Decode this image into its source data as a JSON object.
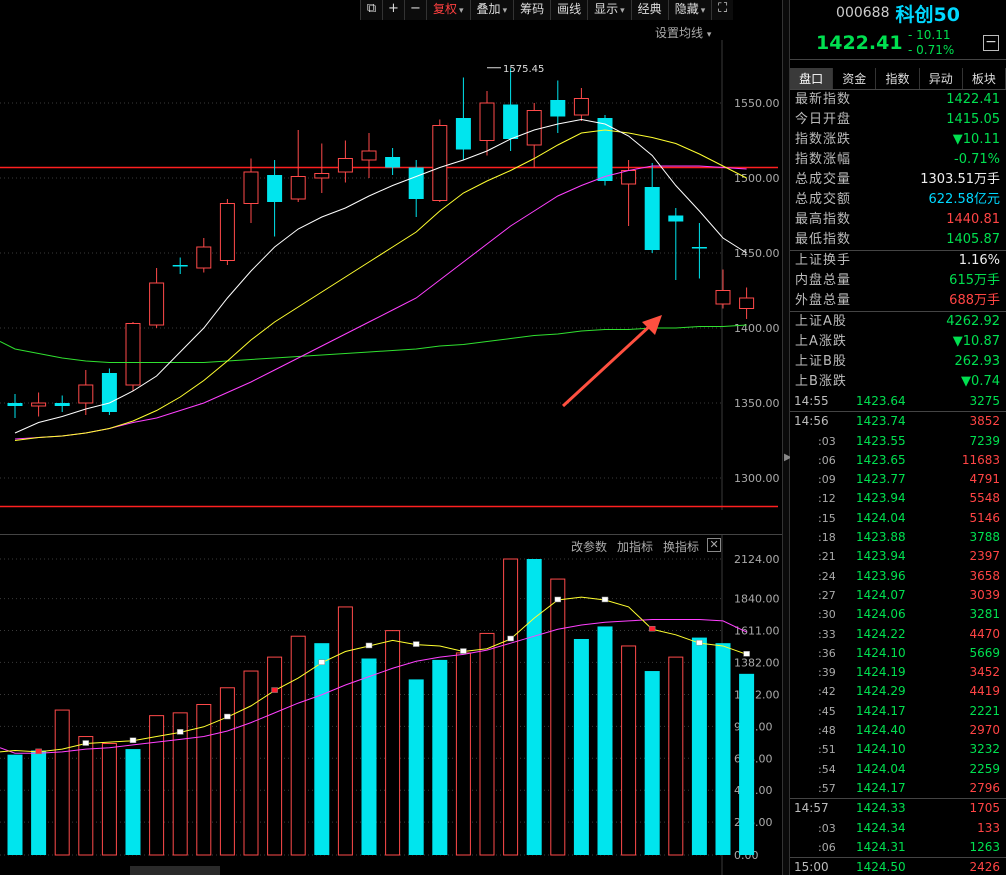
{
  "toolbar": {
    "icon1": "⧉",
    "plus": "+",
    "minus": "−",
    "fuquan": "复权",
    "overlay": "叠加",
    "chips": "筹码",
    "draw": "画线",
    "display": "显示",
    "classic": "经典",
    "hide": "隐藏",
    "full": "⛶"
  },
  "set_ma": "设置均线",
  "vol_panel": {
    "edit_params": "改参数",
    "add_indicator": "加指标",
    "switch_indicator": "换指标",
    "close": "✕"
  },
  "colors": {
    "up": "#ff4a4a",
    "down": "#00e5ee",
    "ma5": "#ffffff",
    "ma10": "#ffff30",
    "ma20": "#ff40ff",
    "ma60": "#30e030",
    "hline": "#ff2020"
  },
  "chart_data": [
    {
      "type": "candlestick",
      "title": "",
      "ylim": [
        1270,
        1600
      ],
      "yticks": [
        "1550.00",
        "1500.00",
        "1450.00",
        "1400.00",
        "1350.00",
        "1300.00"
      ],
      "high_label": "1575.45",
      "hlines": [
        1507,
        1281
      ],
      "candles": [
        {
          "o": 1350,
          "c": 1348,
          "h": 1356,
          "l": 1340
        },
        {
          "o": 1348,
          "c": 1350,
          "h": 1357,
          "l": 1341
        },
        {
          "o": 1350,
          "c": 1348,
          "h": 1355,
          "l": 1344
        },
        {
          "o": 1350,
          "c": 1362,
          "h": 1372,
          "l": 1342
        },
        {
          "o": 1370,
          "c": 1344,
          "h": 1373,
          "l": 1342
        },
        {
          "o": 1362,
          "c": 1403,
          "h": 1404,
          "l": 1358
        },
        {
          "o": 1402,
          "c": 1430,
          "h": 1440,
          "l": 1400
        },
        {
          "o": 1442,
          "c": 1441,
          "h": 1447,
          "l": 1436
        },
        {
          "o": 1440,
          "c": 1454,
          "h": 1460,
          "l": 1437
        },
        {
          "o": 1445,
          "c": 1483,
          "h": 1486,
          "l": 1442
        },
        {
          "o": 1483,
          "c": 1504,
          "h": 1513,
          "l": 1470
        },
        {
          "o": 1502,
          "c": 1484,
          "h": 1512,
          "l": 1461
        },
        {
          "o": 1486,
          "c": 1501,
          "h": 1532,
          "l": 1484
        },
        {
          "o": 1500,
          "c": 1503,
          "h": 1523,
          "l": 1490
        },
        {
          "o": 1504,
          "c": 1513,
          "h": 1525,
          "l": 1497
        },
        {
          "o": 1512,
          "c": 1518,
          "h": 1530,
          "l": 1500
        },
        {
          "o": 1514,
          "c": 1507,
          "h": 1520,
          "l": 1502
        },
        {
          "o": 1507,
          "c": 1486,
          "h": 1512,
          "l": 1474
        },
        {
          "o": 1485,
          "c": 1535,
          "h": 1539,
          "l": 1484
        },
        {
          "o": 1540,
          "c": 1519,
          "h": 1567,
          "l": 1512
        },
        {
          "o": 1525,
          "c": 1550,
          "h": 1558,
          "l": 1515
        },
        {
          "o": 1549,
          "c": 1526,
          "h": 1573,
          "l": 1518
        },
        {
          "o": 1522,
          "c": 1545,
          "h": 1550,
          "l": 1507
        },
        {
          "o": 1552,
          "c": 1541,
          "h": 1565,
          "l": 1530
        },
        {
          "o": 1542,
          "c": 1553,
          "h": 1560,
          "l": 1538
        },
        {
          "o": 1540,
          "c": 1498,
          "h": 1542,
          "l": 1495
        },
        {
          "o": 1496,
          "c": 1505,
          "h": 1512,
          "l": 1468
        },
        {
          "o": 1494,
          "c": 1452,
          "h": 1510,
          "l": 1450
        },
        {
          "o": 1475,
          "c": 1471,
          "h": 1480,
          "l": 1432
        },
        {
          "o": 1454,
          "c": 1453,
          "h": 1470,
          "l": 1433
        },
        {
          "o": 1416,
          "c": 1425,
          "h": 1439,
          "l": 1413
        },
        {
          "o": 1413,
          "c": 1420,
          "h": 1427,
          "l": 1406
        }
      ],
      "ma5": [
        1330,
        1337,
        1341,
        1346,
        1350,
        1358,
        1368,
        1384,
        1400,
        1420,
        1438,
        1454,
        1466,
        1474,
        1480,
        1488,
        1495,
        1501,
        1507,
        1512,
        1518,
        1526,
        1532,
        1536,
        1539,
        1536,
        1528,
        1515,
        1495,
        1478,
        1460,
        1450
      ],
      "ma10": [
        1325,
        1327,
        1328,
        1330,
        1333,
        1338,
        1345,
        1354,
        1365,
        1378,
        1392,
        1404,
        1414,
        1424,
        1434,
        1444,
        1454,
        1464,
        1478,
        1490,
        1498,
        1505,
        1513,
        1522,
        1530,
        1532,
        1530,
        1527,
        1523,
        1516,
        1508,
        1500
      ],
      "ma20": [
        1326,
        1327,
        1328,
        1330,
        1333,
        1337,
        1340,
        1345,
        1350,
        1357,
        1364,
        1372,
        1380,
        1388,
        1396,
        1404,
        1412,
        1420,
        1432,
        1444,
        1456,
        1468,
        1478,
        1488,
        1495,
        1501,
        1505,
        1508,
        1508,
        1508,
        1507,
        1506
      ],
      "ma60": [
        1386,
        1383,
        1380,
        1378,
        1377,
        1377,
        1377,
        1377,
        1377,
        1378,
        1379,
        1380,
        1381,
        1382,
        1383,
        1384,
        1385,
        1386,
        1388,
        1389,
        1391,
        1393,
        1395,
        1396,
        1398,
        1399,
        1399,
        1400,
        1400,
        1401,
        1401,
        1402
      ]
    },
    {
      "type": "bar",
      "title": "",
      "ylim": [
        0,
        2124
      ],
      "yticks": [
        "2124.00",
        "1840.00",
        "1611.00",
        "1382.00",
        "1152.00",
        "923.00",
        "694.00",
        "465.00",
        "236.00",
        "0.00"
      ],
      "values": [
        720,
        750,
        1040,
        850,
        800,
        760,
        1000,
        1020,
        1080,
        1200,
        1320,
        1420,
        1570,
        1520,
        1780,
        1410,
        1610,
        1260,
        1400,
        1450,
        1590,
        2124,
        2124,
        1980,
        1550,
        1640,
        1500,
        1320,
        1420,
        1560,
        1520,
        1300
      ],
      "colors": [
        "down",
        "down",
        "up",
        "up",
        "up",
        "down",
        "up",
        "up",
        "up",
        "up",
        "up",
        "up",
        "up",
        "down",
        "up",
        "down",
        "up",
        "down",
        "down",
        "up",
        "up",
        "up",
        "down",
        "up",
        "down",
        "down",
        "up",
        "down",
        "up",
        "down",
        "down",
        "down"
      ],
      "mavol5": [
        750,
        740,
        760,
        800,
        810,
        820,
        850,
        880,
        920,
        990,
        1070,
        1180,
        1270,
        1380,
        1460,
        1500,
        1540,
        1510,
        1500,
        1460,
        1480,
        1550,
        1700,
        1830,
        1850,
        1830,
        1780,
        1620,
        1580,
        1520,
        1500,
        1440
      ],
      "mavol10": [
        730,
        730,
        740,
        760,
        770,
        790,
        810,
        830,
        850,
        890,
        950,
        1020,
        1090,
        1150,
        1220,
        1280,
        1340,
        1390,
        1420,
        1440,
        1470,
        1520,
        1570,
        1620,
        1650,
        1670,
        1680,
        1690,
        1690,
        1690,
        1680,
        1600
      ]
    }
  ],
  "quote": {
    "code": "000688",
    "name": "科创50",
    "price": "1422.41",
    "change": "- 10.11",
    "change_pct": "- 0.71%",
    "toggle": "−"
  },
  "tabs": [
    "盘口",
    "资金",
    "指数",
    "异动",
    "板块"
  ],
  "stats_groups": [
    [
      {
        "label": "最新指数",
        "value": "1422.41",
        "cls": ""
      },
      {
        "label": "今日开盘",
        "value": "1415.05",
        "cls": ""
      },
      {
        "label": "指数涨跌",
        "value": "▼10.11",
        "cls": ""
      },
      {
        "label": "指数涨幅",
        "value": "-0.71%",
        "cls": ""
      },
      {
        "label": "总成交量",
        "value": "1303.51万手",
        "cls": "w"
      },
      {
        "label": "总成交额",
        "value": "622.58亿元",
        "cls": "c"
      },
      {
        "label": "最高指数",
        "value": "1440.81",
        "cls": "r"
      },
      {
        "label": "最低指数",
        "value": "1405.87",
        "cls": ""
      }
    ],
    [
      {
        "label": "上证换手",
        "value": "1.16%",
        "cls": "w"
      },
      {
        "label": "内盘总量",
        "value": "615万手",
        "cls": ""
      },
      {
        "label": "外盘总量",
        "value": "688万手",
        "cls": "r"
      }
    ],
    [
      {
        "label": "上证A股",
        "value": "4262.92",
        "cls": ""
      },
      {
        "label": "上A涨跌",
        "value": "▼10.87",
        "cls": ""
      },
      {
        "label": "上证B股",
        "value": "262.93",
        "cls": ""
      },
      {
        "label": "上B涨跌",
        "value": "▼0.74",
        "cls": ""
      }
    ]
  ],
  "trade_groups": [
    [
      {
        "t": "14:55",
        "p": "1423.64",
        "v": "3275",
        "vc": "g"
      }
    ],
    [
      {
        "t": "14:56",
        "p": "1423.74",
        "v": "3852",
        "vc": "r"
      },
      {
        "t": ":03",
        "p": "1423.55",
        "v": "7239",
        "vc": "g"
      },
      {
        "t": ":06",
        "p": "1423.65",
        "v": "11683",
        "vc": "r"
      },
      {
        "t": ":09",
        "p": "1423.77",
        "v": "4791",
        "vc": "r"
      },
      {
        "t": ":12",
        "p": "1423.94",
        "v": "5548",
        "vc": "r"
      },
      {
        "t": ":15",
        "p": "1424.04",
        "v": "5146",
        "vc": "r"
      },
      {
        "t": ":18",
        "p": "1423.88",
        "v": "3788",
        "vc": "g"
      },
      {
        "t": ":21",
        "p": "1423.94",
        "v": "2397",
        "vc": "r"
      },
      {
        "t": ":24",
        "p": "1423.96",
        "v": "3658",
        "vc": "r"
      },
      {
        "t": ":27",
        "p": "1424.07",
        "v": "3039",
        "vc": "r"
      },
      {
        "t": ":30",
        "p": "1424.06",
        "v": "3281",
        "vc": "g"
      },
      {
        "t": ":33",
        "p": "1424.22",
        "v": "4470",
        "vc": "r"
      },
      {
        "t": ":36",
        "p": "1424.10",
        "v": "5669",
        "vc": "g"
      },
      {
        "t": ":39",
        "p": "1424.19",
        "v": "3452",
        "vc": "r"
      },
      {
        "t": ":42",
        "p": "1424.29",
        "v": "4419",
        "vc": "r"
      },
      {
        "t": ":45",
        "p": "1424.17",
        "v": "2221",
        "vc": "g"
      },
      {
        "t": ":48",
        "p": "1424.40",
        "v": "2970",
        "vc": "r"
      },
      {
        "t": ":51",
        "p": "1424.10",
        "v": "3232",
        "vc": "g"
      },
      {
        "t": ":54",
        "p": "1424.04",
        "v": "2259",
        "vc": "g"
      },
      {
        "t": ":57",
        "p": "1424.17",
        "v": "2796",
        "vc": "r"
      }
    ],
    [
      {
        "t": "14:57",
        "p": "1424.33",
        "v": "1705",
        "vc": "r"
      },
      {
        "t": ":03",
        "p": "1424.34",
        "v": "133",
        "vc": "r"
      },
      {
        "t": ":06",
        "p": "1424.31",
        "v": "1263",
        "vc": "g"
      }
    ],
    [
      {
        "t": "15:00",
        "p": "1424.50",
        "v": "2426",
        "vc": "r"
      }
    ]
  ]
}
